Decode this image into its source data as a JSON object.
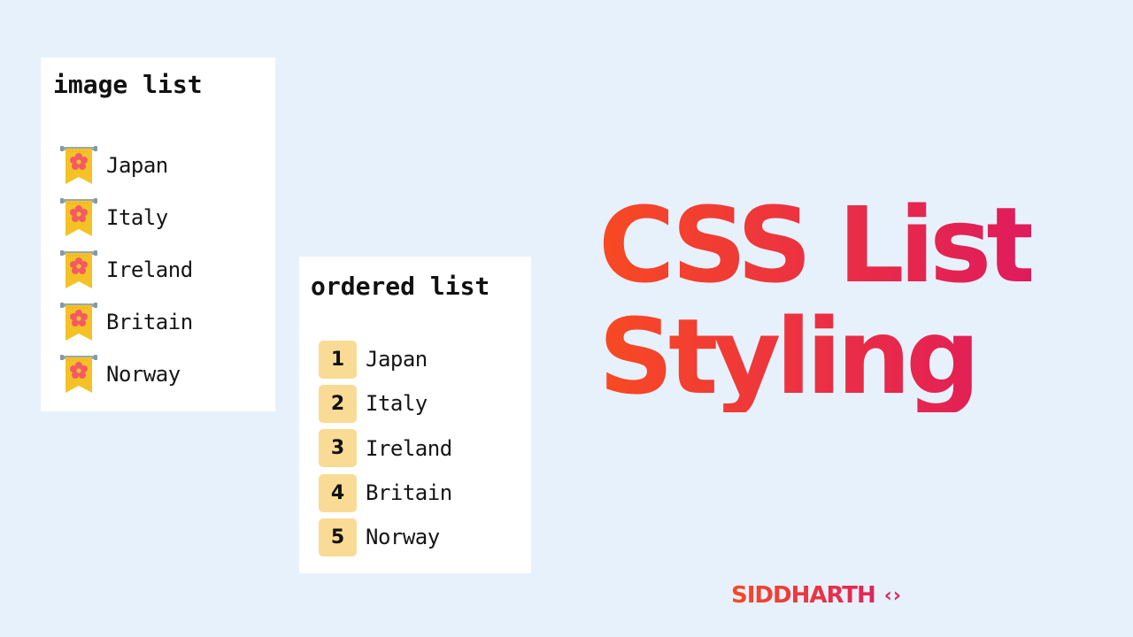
{
  "image_list": {
    "title": "image list",
    "icon": "flower-banner-icon",
    "items": [
      "Japan",
      "Italy",
      "Ireland",
      "Britain",
      "Norway"
    ]
  },
  "ordered_list": {
    "title": "ordered list",
    "items": [
      {
        "number": "1",
        "label": "Japan"
      },
      {
        "number": "2",
        "label": "Italy"
      },
      {
        "number": "3",
        "label": "Ireland"
      },
      {
        "number": "4",
        "label": "Britain"
      },
      {
        "number": "5",
        "label": "Norway"
      }
    ],
    "badge_color": "#f9db95"
  },
  "hero": {
    "line1": "CSS List",
    "line2": "Styling",
    "gradient_start": "#f84a23",
    "gradient_end": "#df1b5c"
  },
  "brand": {
    "name": "SIDDHARTH",
    "icon_glyph": "‹›",
    "icon": "code-brackets-icon"
  },
  "background": "#e7f1fb"
}
